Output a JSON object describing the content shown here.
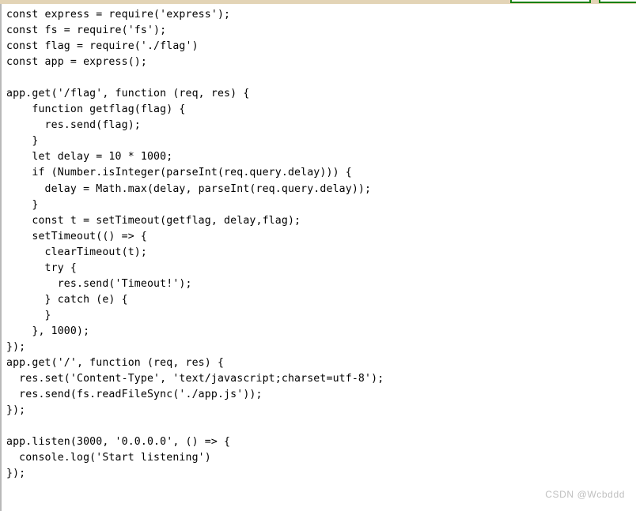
{
  "document": {
    "kind": "source-code-listing",
    "language": "javascript",
    "filename": "app.js"
  },
  "decorations": {
    "top_strip_color": "#e3d4b6",
    "highlight_box_color": "#17820f",
    "left_border_color": "#b9b9b9",
    "background_color": "#ffffff",
    "text_color": "#000000",
    "boxes": [
      {
        "name": "green-highlight-box-left",
        "label": ""
      },
      {
        "name": "green-highlight-box-right",
        "label": ""
      }
    ]
  },
  "code": {
    "lines": [
      "const express = require('express');",
      "const fs = require('fs');",
      "const flag = require('./flag')",
      "const app = express();",
      "",
      "app.get('/flag', function (req, res) {",
      "    function getflag(flag) {",
      "      res.send(flag);",
      "    }",
      "    let delay = 10 * 1000;",
      "    if (Number.isInteger(parseInt(req.query.delay))) {",
      "      delay = Math.max(delay, parseInt(req.query.delay));",
      "    }",
      "    const t = setTimeout(getflag, delay,flag);",
      "    setTimeout(() => {",
      "      clearTimeout(t);",
      "      try {",
      "        res.send('Timeout!');",
      "      } catch (e) {",
      "      }",
      "    }, 1000);",
      "});",
      "app.get('/', function (req, res) {",
      "  res.set('Content-Type', 'text/javascript;charset=utf-8');",
      "  res.send(fs.readFileSync('./app.js'));",
      "});",
      "",
      "app.listen(3000, '0.0.0.0', () => {",
      "  console.log('Start listening')",
      "});"
    ]
  },
  "watermark": {
    "text": "CSDN @Wcbddd"
  }
}
